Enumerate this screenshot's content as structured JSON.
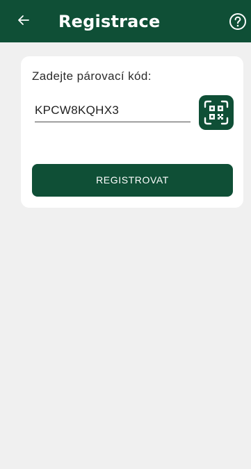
{
  "header": {
    "title": "Registrace",
    "back_icon": "arrow-left-icon",
    "help_icon": "help-circle-icon"
  },
  "form": {
    "label": "Zadejte párovací kód:",
    "code_value": "KPCW8KQHX3",
    "qr_icon": "qr-scan-icon",
    "register_label": "REGISTROVAT"
  },
  "colors": {
    "brand": "#0f4f36",
    "background": "#f0f0f0",
    "card": "#ffffff"
  }
}
